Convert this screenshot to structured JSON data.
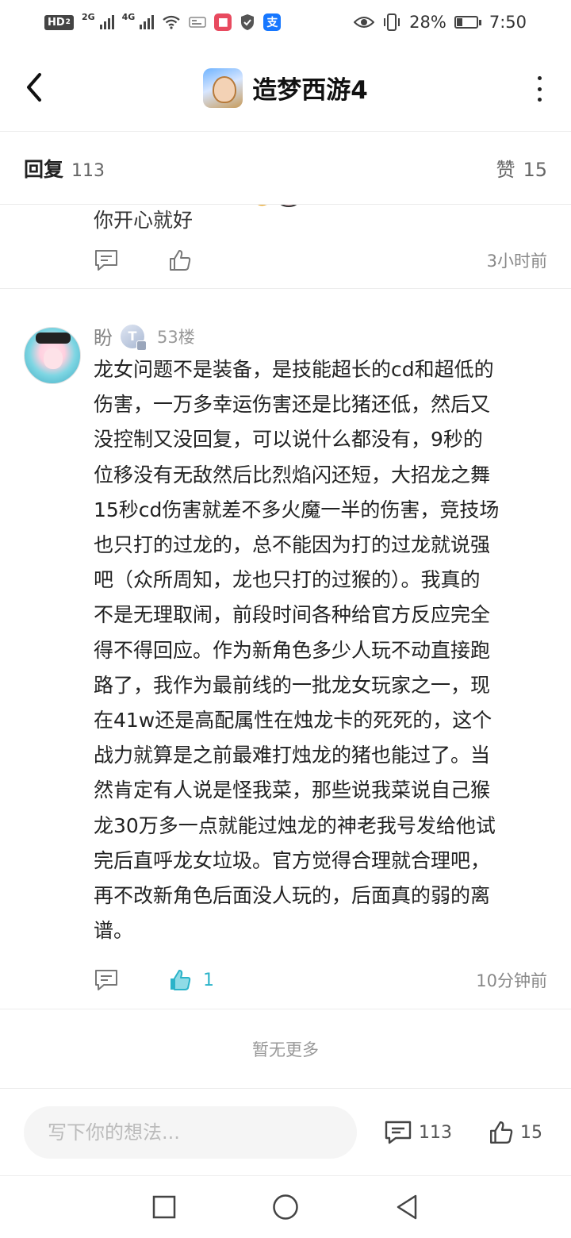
{
  "status_bar": {
    "hd": "HD",
    "hd_sub": "2",
    "net1": "2G",
    "net2": "4G",
    "battery_percent": "28%",
    "battery_level": 0.28,
    "time": "7:50"
  },
  "header": {
    "title": "造梦西游4"
  },
  "reply_bar": {
    "label": "回复",
    "count": "113",
    "like_label": "赞",
    "like_count": "15"
  },
  "previous_comment": {
    "text": "你开心就好",
    "time": "3小时前"
  },
  "main_comment": {
    "author": "盼",
    "level": "T",
    "floor": "53楼",
    "lines": [
      "龙女问题不是装备，是技能超长的cd和超低的",
      "伤害，一万多幸运伤害还是比猪还低，然后又",
      "没控制又没回复，可以说什么都没有，9秒的",
      "位移没有无敌然后比烈焰闪还短，大招龙之舞",
      "15秒cd伤害就差不多火魔一半的伤害，竞技场",
      "也只打的过龙的，总不能因为打的过龙就说强",
      "吧（众所周知，龙也只打的过猴的）。我真的",
      "不是无理取闹，前段时间各种给官方反应完全",
      "得不得回应。作为新角色多少人玩不动直接跑",
      "路了，我作为最前线的一批龙女玩家之一，现",
      "在41w还是高配属性在烛龙卡的死死的，这个",
      "战力就算是之前最难打烛龙的猪也能过了。当",
      "然肯定有人说是怪我菜，那些说我菜说自己猴",
      "龙30万多一点就能过烛龙的神老我号发给他试",
      "完后直呼龙女垃圾。官方觉得合理就合理吧，",
      "再不改新角色后面没人玩的，后面真的弱的离",
      "谱。"
    ],
    "like_count": "1",
    "time": "10分钟前"
  },
  "footer_note": "暂无更多",
  "input_bar": {
    "placeholder": "写下你的想法...",
    "comment_count": "113",
    "like_count": "15"
  },
  "colors": {
    "accent": "#2bb3c9",
    "muted": "#888888"
  }
}
